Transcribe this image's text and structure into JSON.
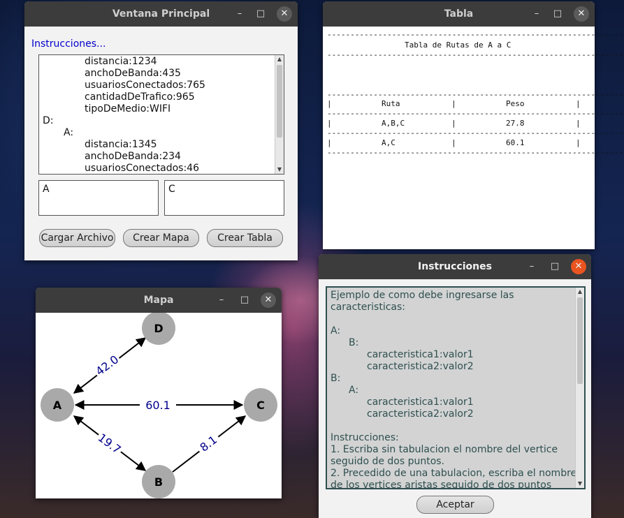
{
  "principal": {
    "title": "Ventana Principal",
    "minimize": "–",
    "maximize": "□",
    "close": "✕",
    "instructions_link": "Instrucciones...",
    "file_lines": [
      {
        "indent": 2,
        "text": "distancia:1234"
      },
      {
        "indent": 2,
        "text": "anchoDeBanda:435"
      },
      {
        "indent": 2,
        "text": "usuariosConectados:765"
      },
      {
        "indent": 2,
        "text": "cantidadDeTrafico:965"
      },
      {
        "indent": 2,
        "text": "tipoDeMedio:WIFI"
      },
      {
        "indent": 0,
        "text": "D:"
      },
      {
        "indent": 1,
        "text": "A:"
      },
      {
        "indent": 2,
        "text": "distancia:1345"
      },
      {
        "indent": 2,
        "text": "anchoDeBanda:234"
      },
      {
        "indent": 2,
        "text": "usuariosConectados:46"
      }
    ],
    "origin_value": "A",
    "destination_value": "C",
    "load_button": "Cargar Archivo",
    "map_button": "Crear Mapa",
    "table_button": "Crear Tabla"
  },
  "tabla": {
    "title": "Tabla",
    "minimize": "–",
    "maximize": "□",
    "close": "✕",
    "rule": "--------------------------------------------------------------------",
    "heading": "Tabla de Rutas de A a C",
    "col_route": "Ruta",
    "col_weight": "Peso",
    "rows": [
      {
        "route": "A,B,C",
        "weight": "27.8"
      },
      {
        "route": "A,C",
        "weight": "60.1"
      }
    ],
    "bar": "|"
  },
  "mapa": {
    "title": "Mapa",
    "minimize": "–",
    "maximize": "□",
    "close": "✕",
    "nodes": [
      "D",
      "A",
      "C",
      "B"
    ],
    "edges": [
      {
        "from": "A",
        "to": "D",
        "label": "42.0"
      },
      {
        "from": "A",
        "to": "C",
        "label": "60.1"
      },
      {
        "from": "A",
        "to": "B",
        "label": "19.7"
      },
      {
        "from": "B",
        "to": "C",
        "label": "8.1"
      }
    ]
  },
  "instrucciones": {
    "title": "Instrucciones",
    "minimize": "–",
    "maximize": "□",
    "close": "✕",
    "lines": [
      {
        "indent": 0,
        "text": "Ejemplo de como debe ingresarse las"
      },
      {
        "indent": 0,
        "text": "caracteristicas:"
      },
      {
        "indent": 0,
        "text": ""
      },
      {
        "indent": 0,
        "text": "A:"
      },
      {
        "indent": 1,
        "text": "B:"
      },
      {
        "indent": 2,
        "text": "caracteristica1:valor1"
      },
      {
        "indent": 2,
        "text": "caracteristica2:valor2"
      },
      {
        "indent": 0,
        "text": "B:"
      },
      {
        "indent": 1,
        "text": "A:"
      },
      {
        "indent": 2,
        "text": "caracteristica1:valor1"
      },
      {
        "indent": 2,
        "text": "caracteristica2:valor2"
      },
      {
        "indent": 0,
        "text": ""
      },
      {
        "indent": 0,
        "text": "Instrucciones:"
      },
      {
        "indent": 0,
        "text": "1. Escriba sin tabulacion el nombre del vertice"
      },
      {
        "indent": 0,
        "text": "seguido de dos puntos."
      },
      {
        "indent": 0,
        "text": "2. Precedido de una tabulacion, escriba el nombre"
      },
      {
        "indent": 0,
        "text": "de los vertices aristas seguido de dos puntos"
      }
    ],
    "accept_button": "Aceptar"
  },
  "colors": {
    "titlebar": "#3c3c3c",
    "link": "#0000cc",
    "edge_label": "#00008b",
    "node_fill": "#a9a9a9",
    "close_active": "#e95420"
  }
}
